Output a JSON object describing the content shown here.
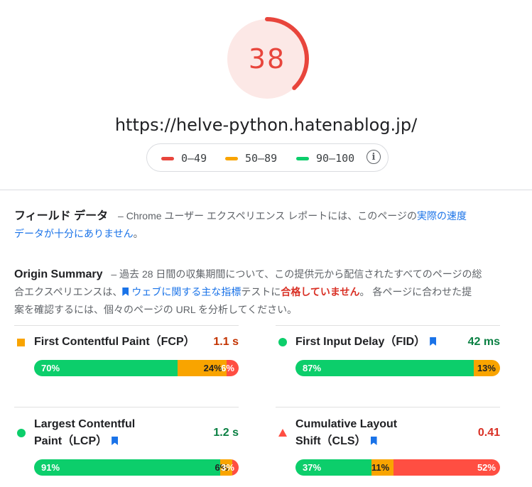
{
  "score": {
    "value": "38",
    "fraction": 0.38,
    "color": "#e8453c",
    "bg": "#fce8e6"
  },
  "url": "https://helve-python.hatenablog.jp/",
  "legend": [
    {
      "label": "0–49",
      "color": "#e8453c"
    },
    {
      "label": "50–89",
      "color": "#f9a400"
    },
    {
      "label": "90–100",
      "color": "#0cce6b"
    }
  ],
  "field": {
    "title": "フィールド データ",
    "dash": "–",
    "line1": "Chrome ユーザー エクスペリエンス レポートには、このページの",
    "link": "実際の速度",
    "line2": "データが十分にありません",
    "line2_end": "。"
  },
  "origin": {
    "title": "Origin Summary",
    "text1": "– 過去 28 日間の収集期間について、この提供元から配信されたすべてのページの総",
    "text2a": "合エクスペリエンスは、",
    "link": "ウェブに関する主な指標",
    "text2b": "テストに",
    "fail": "合格していません",
    "text2c": "。 各ページに合わせた提",
    "text3": "案を確認するには、個々のページの URL を分析してください。"
  },
  "metrics": [
    {
      "name": "First Contentful Paint（FCP）",
      "value": "1.1 s",
      "value_color": "#c33300",
      "indicator": "square",
      "ind_color": "#f9a400",
      "segments": [
        {
          "label": "70%",
          "fraction": 0.7,
          "color": "#0cce6b"
        },
        {
          "label": "24%",
          "fraction": 0.24,
          "color": "#f9a400"
        },
        {
          "label": "6%",
          "fraction": 0.06,
          "color": "#ff4e42"
        }
      ]
    },
    {
      "name": "First Input Delay（FID）",
      "value": "42 ms",
      "value_color": "#0b8043",
      "indicator": "circle",
      "ind_color": "#0cce6b",
      "segments": [
        {
          "label": "87%",
          "fraction": 0.87,
          "color": "#0cce6b"
        },
        {
          "label": "13%",
          "fraction": 0.13,
          "color": "#f9a400"
        }
      ]
    },
    {
      "name1": "Largest Contentful",
      "name2": "Paint（LCP）",
      "value": "1.2 s",
      "value_color": "#0b8043",
      "indicator": "circle",
      "ind_color": "#0cce6b",
      "segments": [
        {
          "label": "91%",
          "fraction": 0.91,
          "color": "#0cce6b"
        },
        {
          "label": "6%",
          "fraction": 0.06,
          "color": "#f9a400"
        },
        {
          "label": "3%",
          "fraction": 0.03,
          "color": "#ff4e42"
        }
      ]
    },
    {
      "name1": "Cumulative Layout",
      "name2": "Shift（CLS）",
      "value": "0.41",
      "value_color": "#d93025",
      "indicator": "triangle",
      "ind_color": "#ff4e42",
      "segments": [
        {
          "label": "37%",
          "fraction": 0.37,
          "color": "#0cce6b"
        },
        {
          "label": "11%",
          "fraction": 0.11,
          "color": "#f9a400"
        },
        {
          "label": "52%",
          "fraction": 0.52,
          "color": "#ff4e42"
        }
      ]
    }
  ]
}
